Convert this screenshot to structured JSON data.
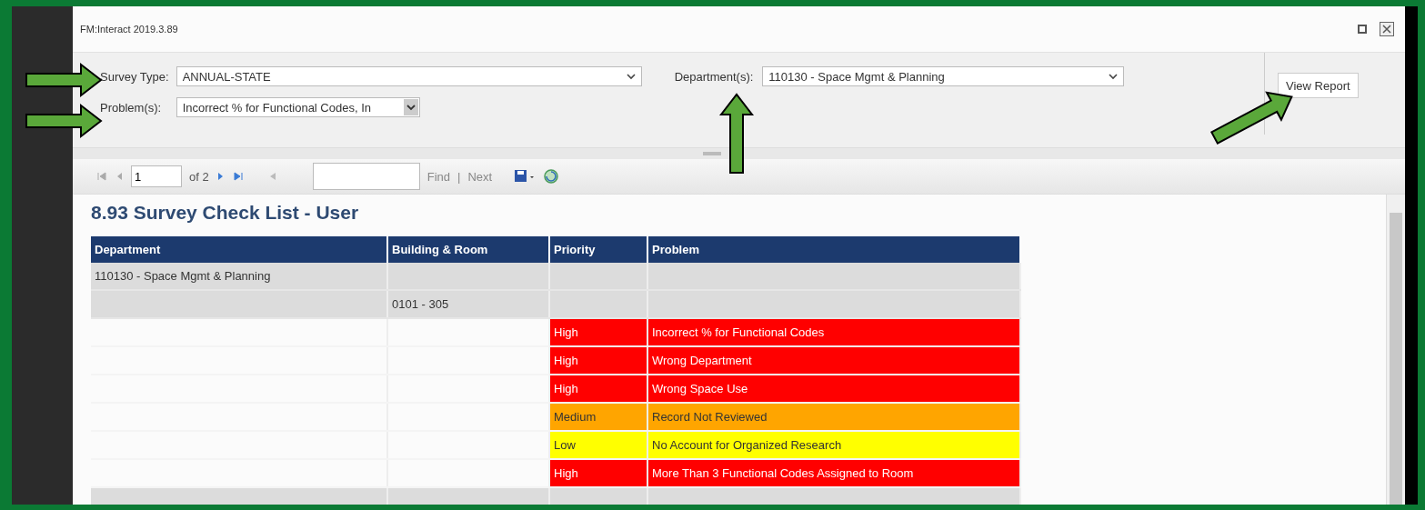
{
  "window": {
    "title": "FM:Interact 2019.3.89"
  },
  "filters": {
    "survey_type": {
      "label": "Survey Type:",
      "value": "ANNUAL-STATE"
    },
    "problems": {
      "label": "Problem(s):",
      "value": "Incorrect % for Functional Codes, In"
    },
    "departments": {
      "label": "Department(s):",
      "value": "110130 - Space Mgmt & Planning"
    },
    "view_report_button": "View Report"
  },
  "toolbar": {
    "page": "1",
    "page_count": "of 2",
    "find": "Find",
    "separator": "|",
    "next": "Next"
  },
  "report": {
    "title": "8.93 Survey Check List - User",
    "columns": [
      "Department",
      "Building & Room",
      "Priority",
      "Problem"
    ],
    "rows": [
      {
        "kind": "department",
        "department": "110130 - Space Mgmt & Planning"
      },
      {
        "kind": "room",
        "room": "0101 - 305"
      },
      {
        "kind": "problem",
        "priority": "High",
        "problem": "Incorrect % for Functional Codes",
        "color": "#ff0000"
      },
      {
        "kind": "problem",
        "priority": "High",
        "problem": "Wrong Department",
        "color": "#ff0000"
      },
      {
        "kind": "problem",
        "priority": "High",
        "problem": "Wrong Space Use",
        "color": "#ff0000"
      },
      {
        "kind": "problem",
        "priority": "Medium",
        "problem": "Record Not Reviewed",
        "color": "#ffa500"
      },
      {
        "kind": "problem",
        "priority": "Low",
        "problem": "No Account for Organized Research",
        "color": "#ffff00"
      },
      {
        "kind": "problem",
        "priority": "High",
        "problem": "More Than 3 Functional Codes Assigned to Room",
        "color": "#ff0000"
      }
    ]
  }
}
